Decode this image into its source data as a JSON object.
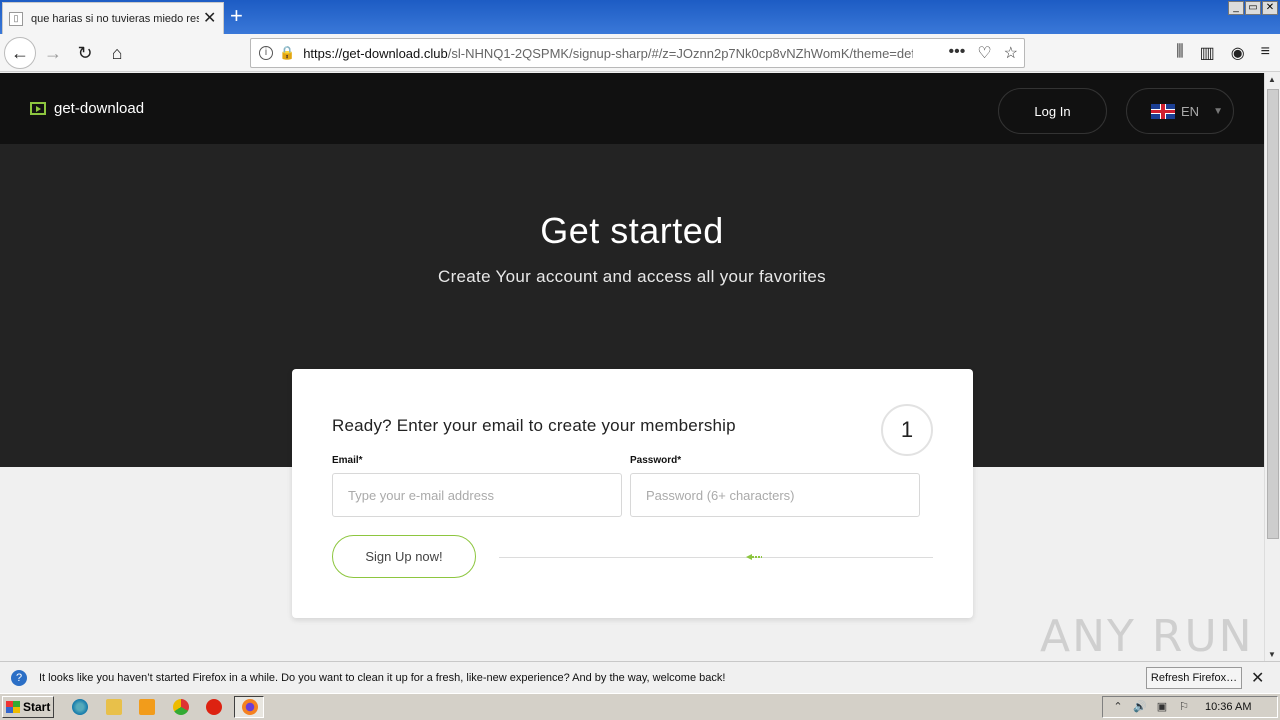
{
  "browser": {
    "tab_title": "que harias si no tuvieras miedo res",
    "tab_close": "✕",
    "new_tab": "+",
    "window_controls": [
      "_",
      "▭",
      "✕"
    ],
    "url_host": "https://get-download.club",
    "url_path": "/sl-NHNQ1-2QSPMK/signup-sharp/#/z=JOznn2p7Nk0cp8vNZhWomK/theme=def"
  },
  "site": {
    "logo_text": "get-download",
    "login_label": "Log In",
    "lang_label": "EN"
  },
  "hero": {
    "title": "Get started",
    "subtitle": "Create Your account and access all your favorites"
  },
  "form": {
    "heading": "Ready? Enter your email to create your membership",
    "step": "1",
    "email_label": "Email*",
    "email_placeholder": "Type your e-mail address",
    "password_label": "Password*",
    "password_placeholder": "Password (6+ characters)",
    "submit_label": "Sign Up now!"
  },
  "watermark": "ANY RUN",
  "notification": {
    "message": "It looks like you haven’t started Firefox in a while. Do you want to clean it up for a fresh, like-new experience? And by the way, welcome back!",
    "refresh_label": "Refresh Firefox…"
  },
  "taskbar": {
    "start_label": "Start",
    "clock": "10:36 AM"
  },
  "colors": {
    "accent": "#8dc63f",
    "header_bg": "#111111",
    "hero_bg": "#232323"
  }
}
